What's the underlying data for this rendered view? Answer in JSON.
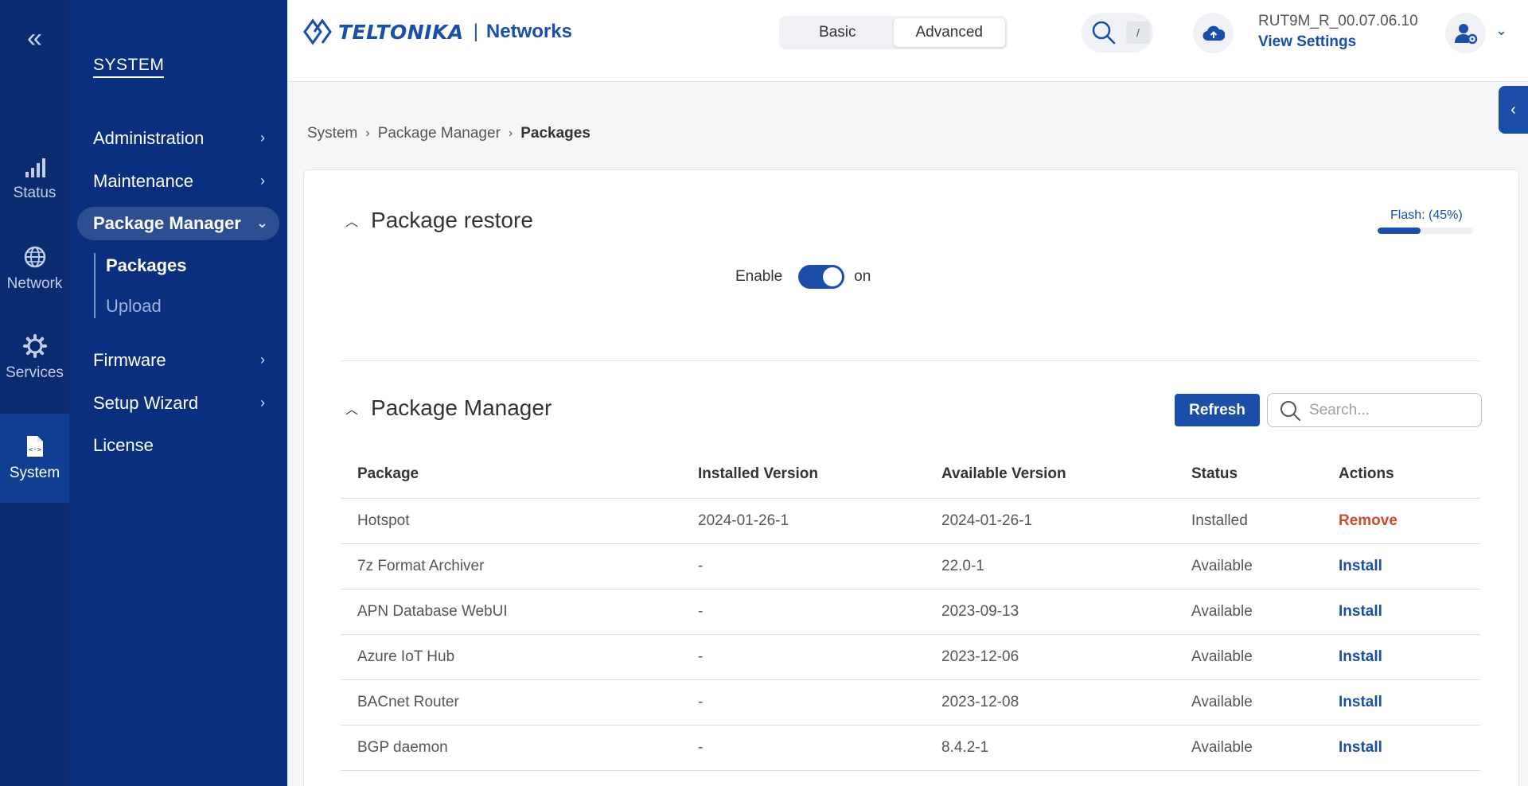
{
  "rail": {
    "items": [
      {
        "label": "Status",
        "icon": "signal-bars-icon"
      },
      {
        "label": "Network",
        "icon": "globe-icon"
      },
      {
        "label": "Services",
        "icon": "gear-icon"
      },
      {
        "label": "System",
        "icon": "code-file-icon",
        "active": true
      }
    ]
  },
  "subnav": {
    "title": "SYSTEM",
    "items": [
      {
        "label": "Administration"
      },
      {
        "label": "Maintenance"
      },
      {
        "label": "Package Manager"
      },
      {
        "label": "Firmware"
      },
      {
        "label": "Setup Wizard"
      },
      {
        "label": "License"
      }
    ],
    "children": [
      {
        "label": "Packages"
      },
      {
        "label": "Upload"
      }
    ]
  },
  "header": {
    "brand": "TELTONIKA",
    "brand_sep": "|",
    "brand_sub": "Networks",
    "mode_basic": "Basic",
    "mode_advanced": "Advanced",
    "search_key": "/",
    "device_name": "RUT9M_R_00.07.06.10",
    "view_settings": "View Settings"
  },
  "breadcrumb": {
    "items": [
      "System",
      "Package Manager",
      "Packages"
    ]
  },
  "restore": {
    "title": "Package restore",
    "flash_label": "Flash: (45%)",
    "flash_fraction": 0.45,
    "enable_label": "Enable",
    "enable_state": "on"
  },
  "manager": {
    "title": "Package Manager",
    "refresh_label": "Refresh",
    "search_placeholder": "Search...",
    "columns": [
      "Package",
      "Installed Version",
      "Available Version",
      "Status",
      "Actions"
    ],
    "rows": [
      {
        "package": "Hotspot",
        "installed": "2024-01-26-1",
        "available": "2024-01-26-1",
        "status": "Installed",
        "action": "Remove"
      },
      {
        "package": "7z Format Archiver",
        "installed": "-",
        "available": "22.0-1",
        "status": "Available",
        "action": "Install"
      },
      {
        "package": "APN Database WebUI",
        "installed": "-",
        "available": "2023-09-13",
        "status": "Available",
        "action": "Install"
      },
      {
        "package": "Azure IoT Hub",
        "installed": "-",
        "available": "2023-12-06",
        "status": "Available",
        "action": "Install"
      },
      {
        "package": "BACnet Router",
        "installed": "-",
        "available": "2023-12-08",
        "status": "Available",
        "action": "Install"
      },
      {
        "package": "BGP daemon",
        "installed": "-",
        "available": "8.4.2-1",
        "status": "Available",
        "action": "Install"
      }
    ]
  },
  "colors": {
    "rail_bg": "#0a2b70",
    "subnav_bg": "#0a2f7e",
    "accent": "#1a4ea8",
    "remove": "#d14b2b"
  }
}
